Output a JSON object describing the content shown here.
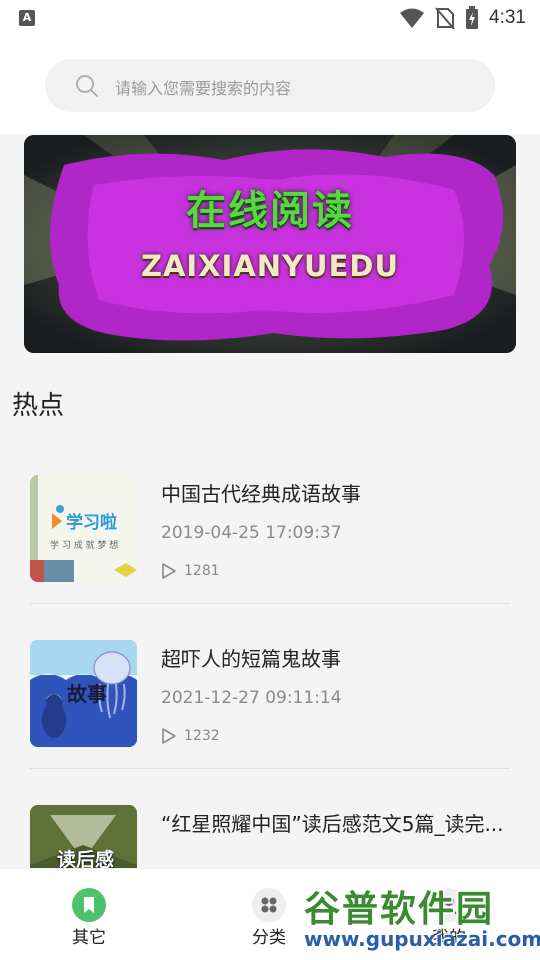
{
  "status_bar": {
    "time": "4:31",
    "left_icon": "A"
  },
  "search": {
    "placeholder": "请输入您需要搜索的内容",
    "icon": "search-icon"
  },
  "banner": {
    "title": "在线阅读",
    "subtitle": "ZAIXIANYUEDU"
  },
  "section": {
    "title": "热点"
  },
  "articles": [
    {
      "title": "中国古代经典成语故事",
      "date": "2019-04-25 17:09:37",
      "plays": "1281",
      "thumb_text": "学习啦",
      "thumb_sub": "学 习 成 就 梦 想"
    },
    {
      "title": "超吓人的短篇鬼故事",
      "date": "2021-12-27 09:11:14",
      "plays": "1232",
      "thumb_text": "故事"
    },
    {
      "title": "“红星照耀中国”读后感范文5篇_读完...",
      "thumb_text": "读后感"
    }
  ],
  "bottom_nav": {
    "items": [
      {
        "label": "其它",
        "icon": "bookmark-icon",
        "active": true
      },
      {
        "label": "分类",
        "icon": "grid-icon"
      },
      {
        "label": "我的",
        "icon": "user-icon"
      }
    ]
  },
  "watermark": {
    "main": "谷普软件园",
    "url": "www.gupuxiazai.com"
  },
  "colors": {
    "accent_green": "#4cc26a",
    "background": "#f4f4f4"
  }
}
